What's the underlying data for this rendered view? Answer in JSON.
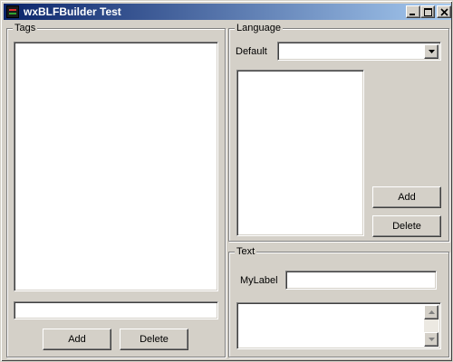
{
  "window": {
    "title": "wxBLFBuilder Test"
  },
  "tags": {
    "group_label": "Tags",
    "input_value": "",
    "add_label": "Add",
    "delete_label": "Delete"
  },
  "language": {
    "group_label": "Language",
    "default_label": "Default",
    "default_selected": "",
    "add_label": "Add",
    "delete_label": "Delete"
  },
  "text": {
    "group_label": "Text",
    "mylabel_label": "MyLabel",
    "mylabel_value": "",
    "multiline_value": ""
  },
  "colors": {
    "face": "#d4d0c8",
    "title_start": "#0a246a",
    "title_end": "#a6caf0"
  }
}
